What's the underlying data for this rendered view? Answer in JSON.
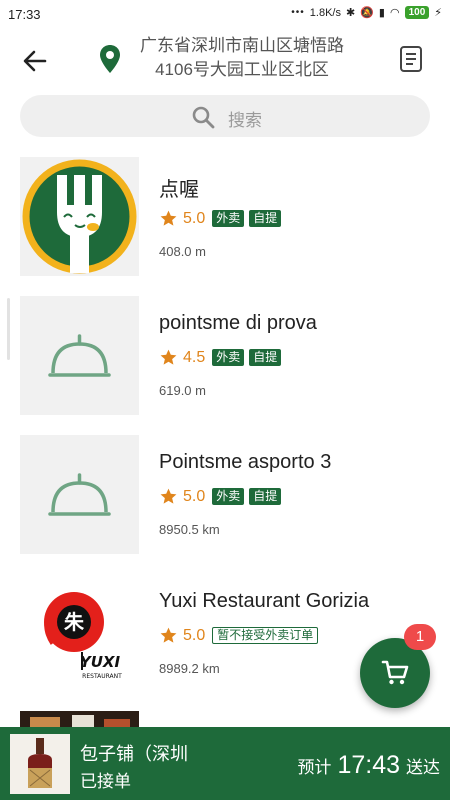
{
  "status_bar": {
    "time": "17:33",
    "speed": "1.8K/s",
    "battery": "100"
  },
  "header": {
    "address_line1": "广东省深圳市南山区塘悟路",
    "address_line2": "4106号大园工业区北区"
  },
  "search": {
    "placeholder": "搜索"
  },
  "restaurants": [
    {
      "name": "点喔",
      "rating": "5.0",
      "tags": [
        "外卖",
        "自提"
      ],
      "distance": "408.0 m",
      "image": "dianwo-logo"
    },
    {
      "name": "pointsme di prova",
      "rating": "4.5",
      "tags": [
        "外卖",
        "自提"
      ],
      "distance": "619.0 m",
      "image": "cloche-placeholder"
    },
    {
      "name": "Pointsme asporto 3",
      "rating": "5.0",
      "tags": [
        "外卖",
        "自提"
      ],
      "distance": "8950.5 km",
      "image": "cloche-placeholder"
    },
    {
      "name": "Yuxi Restaurant Gorizia",
      "rating": "5.0",
      "tags_outline": [
        "暂不接受外卖订单"
      ],
      "distance": "8989.2 km",
      "image": "yuxi-logo",
      "logo_text": "YUXI",
      "logo_sub": "RESTAURANT",
      "logo_char": "朱"
    }
  ],
  "cart": {
    "count": "1"
  },
  "order_bar": {
    "shop_name": "包子铺（深圳",
    "status": "已接单",
    "eta_prefix": "预计",
    "eta_time": "17:43",
    "eta_suffix": "送达"
  },
  "colors": {
    "primary": "#1e6a3a",
    "star": "#e0851c",
    "badge": "#ef4a4a"
  }
}
